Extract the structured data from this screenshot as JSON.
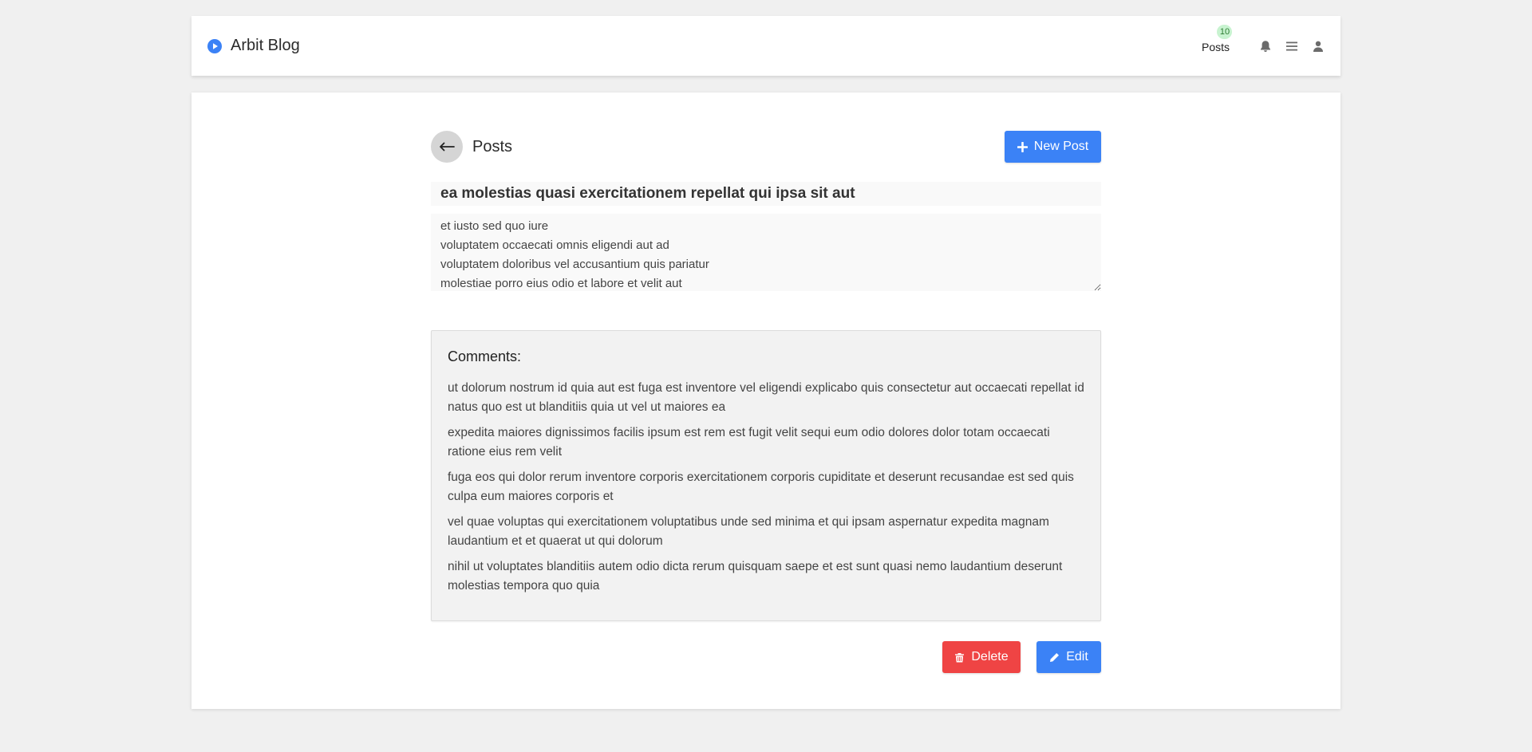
{
  "navbar": {
    "brand": "Arbit Blog",
    "posts_label": "Posts",
    "posts_count": "10",
    "icons": [
      "bell-icon",
      "menu-icon",
      "user-icon"
    ]
  },
  "page": {
    "heading": "Posts",
    "new_post_label": "New Post"
  },
  "post": {
    "title": "ea molestias quasi exercitationem repellat qui ipsa sit aut",
    "body": "et iusto sed quo iure\nvoluptatem occaecati omnis eligendi aut ad\nvoluptatem doloribus vel accusantium quis pariatur\nmolestiae porro eius odio et labore et velit aut"
  },
  "comments": {
    "heading": "Comments:",
    "items": [
      "ut dolorum nostrum id quia aut est fuga est inventore vel eligendi explicabo quis consectetur aut occaecati repellat id natus quo est ut blanditiis quia ut vel ut maiores ea",
      "expedita maiores dignissimos facilis ipsum est rem est fugit velit sequi eum odio dolores dolor totam occaecati ratione eius rem velit",
      "fuga eos qui dolor rerum inventore corporis exercitationem corporis cupiditate et deserunt recusandae est sed quis culpa eum maiores corporis et",
      "vel quae voluptas qui exercitationem voluptatibus unde sed minima et qui ipsam aspernatur expedita magnam laudantium et et quaerat ut qui dolorum",
      "nihil ut voluptates blanditiis autem odio dicta rerum quisquam saepe et est sunt quasi nemo laudantium deserunt molestias tempora quo quia"
    ]
  },
  "actions": {
    "delete_label": "Delete",
    "edit_label": "Edit"
  },
  "colors": {
    "primary": "#3b82f6",
    "danger": "#ef4444",
    "badge_bg": "#c8f3d0",
    "page_bg": "#f0f0f0"
  }
}
